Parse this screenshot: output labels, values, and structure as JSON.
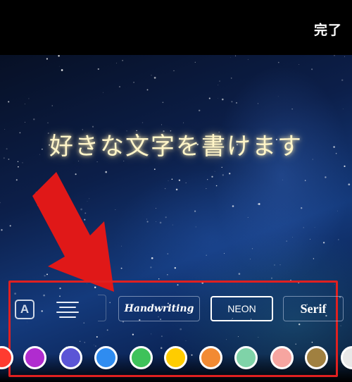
{
  "header": {
    "done_label": "完了"
  },
  "canvas": {
    "overlay_text": "好きな文字を書けます"
  },
  "toolbar": {
    "text_style_icon_label": "A",
    "fonts": [
      {
        "label": "Handwriting"
      },
      {
        "label": "NEON",
        "selected": true
      },
      {
        "label": "Serif"
      }
    ],
    "colors": [
      "#ff3b30",
      "#b02ccf",
      "#5b55d6",
      "#2f8cf0",
      "#3ec25a",
      "#ffcc00",
      "#f28a33",
      "#7fd3a8",
      "#f6a5a0",
      "#a08040",
      "#e8e8e8"
    ]
  },
  "annotation": {
    "arrow_color": "#e01818",
    "highlight_color": "#e02020"
  }
}
